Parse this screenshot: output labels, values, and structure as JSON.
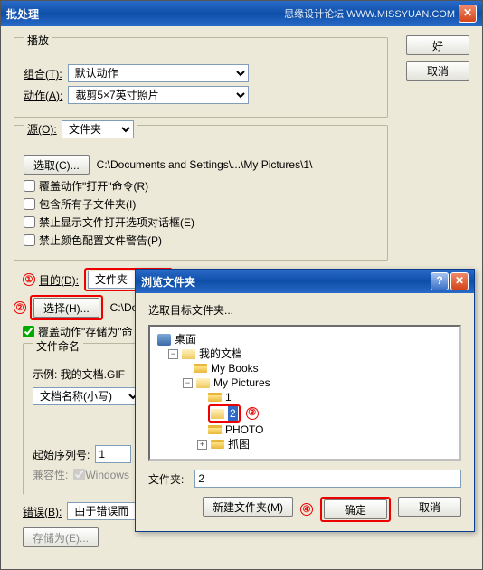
{
  "window": {
    "title": "批处理",
    "watermark": "思缘设计论坛 WWW.MISSYUAN.COM",
    "ok": "好",
    "cancel": "取消"
  },
  "playback": {
    "legend": "播放",
    "setLabel": "组合(T):",
    "setValue": "默认动作",
    "actionLabel": "动作(A):",
    "actionValue": "裁剪5×7英寸照片"
  },
  "source": {
    "legend": "源(O):",
    "value": "文件夹",
    "chooseBtn": "选取(C)...",
    "path": "C:\\Documents and Settings\\...\\My Pictures\\1\\",
    "chk1": "覆盖动作\"打开\"命令(R)",
    "chk2": "包含所有子文件夹(I)",
    "chk3": "禁止显示文件打开选项对话框(E)",
    "chk4": "禁止颜色配置文件警告(P)"
  },
  "dest": {
    "label": "目的(D):",
    "value": "文件夹",
    "chooseBtn": "选择(H)...",
    "path": "C:\\Do",
    "chkOverride": "覆盖动作\"存储为\"命",
    "namingLegend": "文件命名",
    "example": "示例: 我的文档.GIF",
    "fileNameField": "文档名称(小写)",
    "startSeqLabel": "起始序列号:",
    "startSeqValue": "1",
    "compatLabel": "兼容性:",
    "compatValue": "Windows"
  },
  "errors": {
    "label": "错误(B):",
    "value": "由于错误而",
    "saveAsBtn": "存储为(E)..."
  },
  "annotations": {
    "n1": "①",
    "n2": "②",
    "n3": "③",
    "n4": "④"
  },
  "browse": {
    "title": "浏览文件夹",
    "prompt": "选取目标文件夹...",
    "desktop": "桌面",
    "mydocs": "我的文档",
    "mybooks": "My Books",
    "mypics": "My Pictures",
    "f1": "1",
    "f2": "2",
    "fphoto": "PHOTO",
    "fcapture": "抓图",
    "folderLabel": "文件夹:",
    "folderValue": "2",
    "newFolder": "新建文件夹(M)",
    "ok": "确定",
    "cancel": "取消"
  }
}
